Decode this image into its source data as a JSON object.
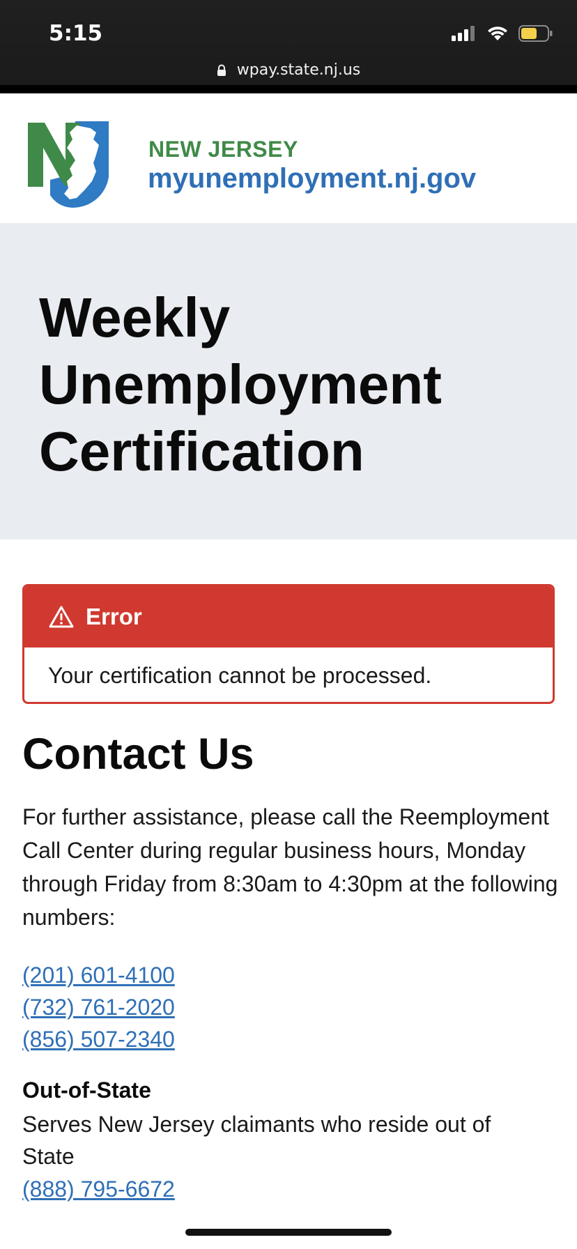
{
  "status_bar": {
    "time": "5:15",
    "url": "wpay.state.nj.us",
    "icons": [
      "cellular-signal-icon",
      "wifi-icon",
      "battery-icon"
    ]
  },
  "header": {
    "state_label": "NEW JERSEY",
    "site_name": "myunemployment.nj.gov",
    "logo_icon": "nj-logo-icon",
    "colors": {
      "green": "#3f8a48",
      "blue": "#2f6fb6"
    }
  },
  "hero": {
    "title": "Weekly Unemployment Certification",
    "background": "#e9ecf1"
  },
  "alert": {
    "title": "Error",
    "message": "Your certification cannot be processed.",
    "icon": "warning-icon",
    "color": "#d0392f"
  },
  "contact": {
    "title": "Contact Us",
    "description": "For further assistance, please call the Reemployment Call Center during regular business hours, Monday through Friday from 8:30am to 4:30pm at the following numbers:",
    "phones": [
      "(201) 601-4100",
      "(732) 761-2020",
      "(856) 507-2340"
    ],
    "out_of_state": {
      "heading": "Out-of-State",
      "text": "Serves New Jersey claimants who reside out of State",
      "phone": "(888) 795-6672"
    },
    "link_color": "#2f6fb6"
  }
}
